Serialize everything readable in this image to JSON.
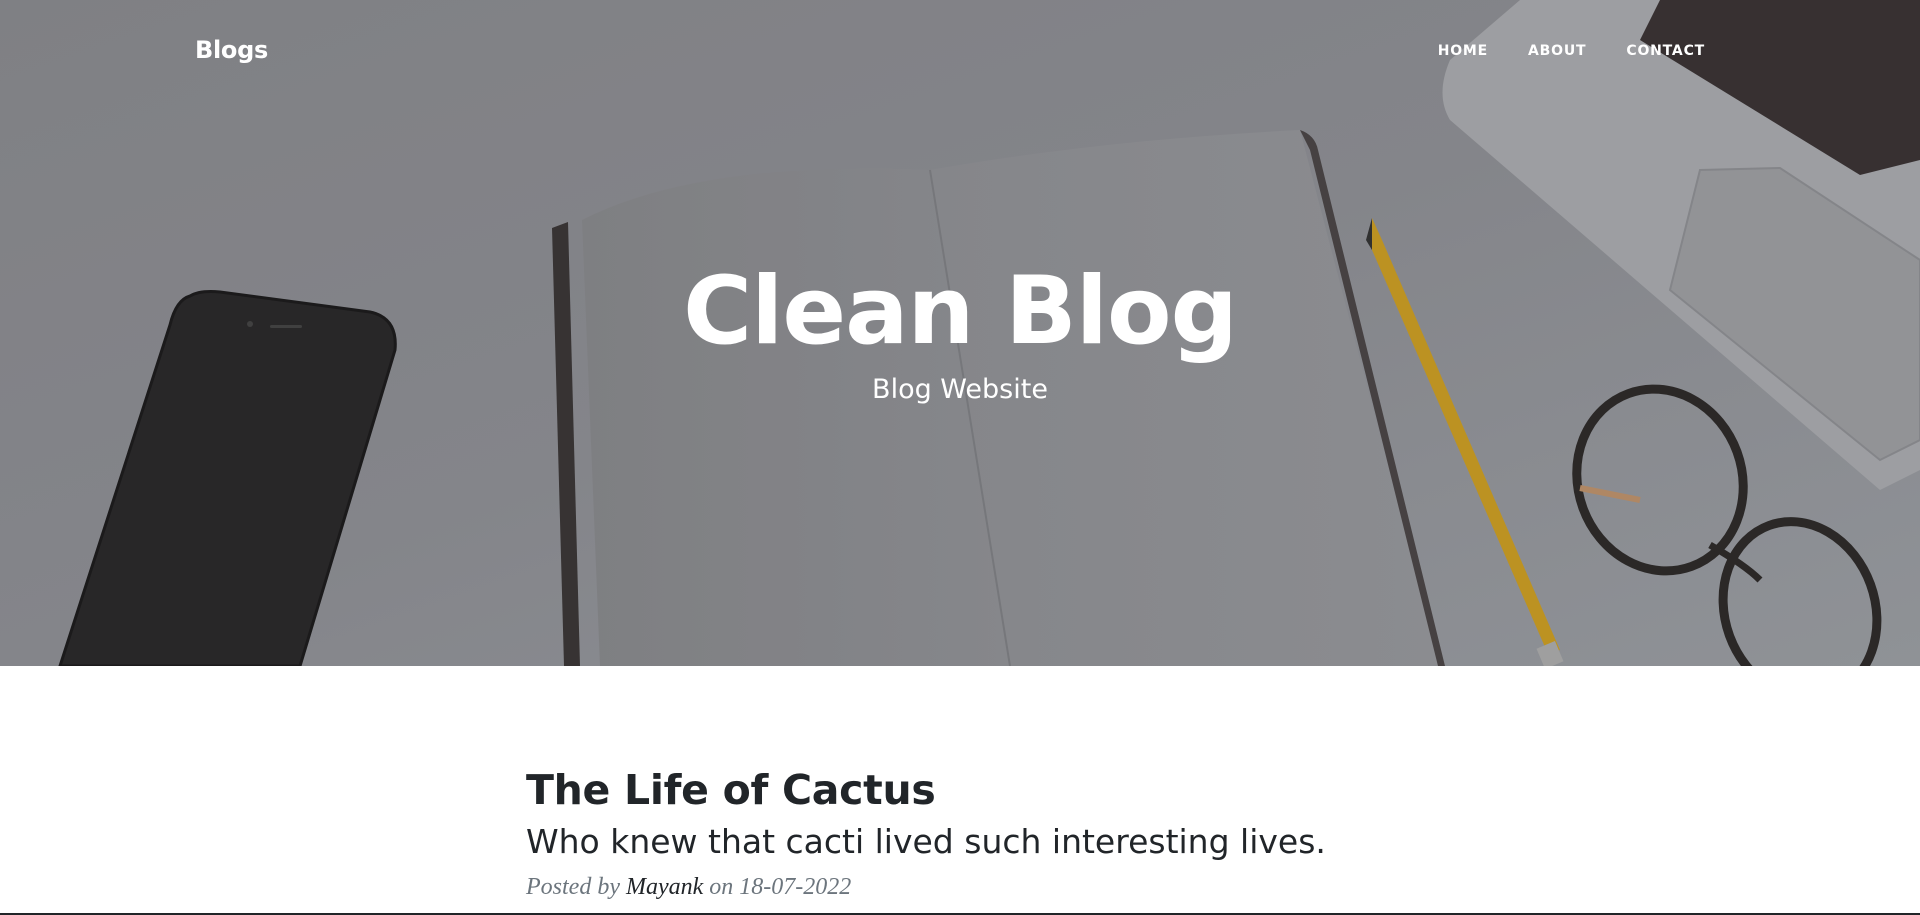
{
  "navbar": {
    "brand": "Blogs",
    "links": [
      {
        "label": "HOME"
      },
      {
        "label": "ABOUT"
      },
      {
        "label": "CONTACT"
      }
    ]
  },
  "hero": {
    "title": "Clean Blog",
    "subtitle": "Blog Website"
  },
  "posts": [
    {
      "title": "The Life of Cactus",
      "subtitle": "Who knew that cacti lived such interesting lives.",
      "meta_prefix": "Posted by",
      "author": "Mayank",
      "meta_on": "on",
      "date": "18-07-2022"
    }
  ],
  "colors": {
    "hero_background": "#8a8b8f",
    "heading_text": "#ffffff",
    "body_text": "#212529",
    "muted_text": "#6c757d"
  }
}
